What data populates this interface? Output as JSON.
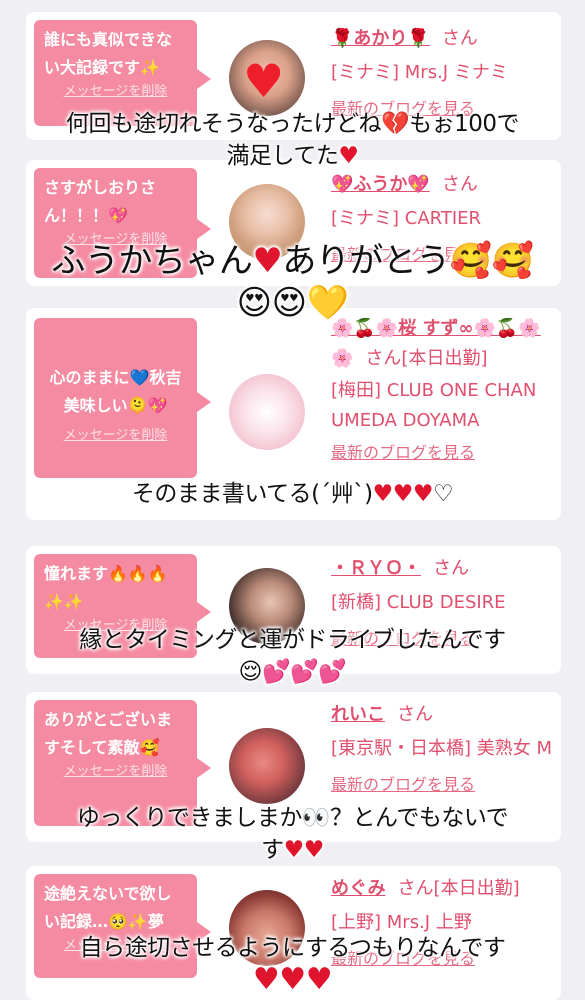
{
  "colors": {
    "accent": "#f58ba2",
    "pink_text": "#e0506e",
    "page_bg": "#f0eff4"
  },
  "delete_label": "メッセージを削除",
  "blog_label": "最新のブログを見る",
  "san": "さん",
  "cards": [
    {
      "message": "誰にも真似できない大記録です✨",
      "name": "🌹あかり🌹",
      "san_suffix": "さん",
      "shop": "[ミナミ] Mrs.J ミナミ"
    },
    {
      "message": "さすがしおりさん！！！💖",
      "name": "💖ふうか💖",
      "san_suffix": "さん",
      "shop": "[ミナミ] CARTIER"
    },
    {
      "message": "心のままに💙秋吉美味しい🫠💖",
      "name": "🌸🍒🌸桜 すず∞🌸🍒🌸",
      "san_suffix": "さん[本日出勤]",
      "shop": "[梅田] CLUB ONE CHAN UMEDA DOYAMA"
    },
    {
      "message": "憧れます🔥🔥🔥✨✨",
      "name": "・ＲＹＯ・",
      "san_suffix": "さん",
      "shop": "[新橋] CLUB DESIRE"
    },
    {
      "message": "ありがとございますそして素敵🥰",
      "name": "れいこ",
      "san_suffix": "さん",
      "shop": "[東京駅・日本橋] 美熟女 M"
    },
    {
      "message": "途絶えないで欲しい記録…🥺✨夢",
      "name": "めぐみ",
      "san_suffix": "さん[本日出勤]",
      "shop": "[上野] Mrs.J 上野"
    }
  ],
  "overlays": [
    {
      "line1": "何回も途切れそうなったけどね💔もぉ100で",
      "line2": "満足してた"
    },
    {
      "line1": "ふうかちゃん",
      "line1b": "ありがとう🥰🥰",
      "line2": "😍😍💛"
    },
    {
      "line1": "そのまま書いてる(´艸`)",
      "line1b": "♡"
    },
    {
      "line1": "縁とタイミングと運がドライブしたんです",
      "line2": "😌💕💕💕"
    },
    {
      "line1": "ゆっくりできましまか👀？とんでもないで",
      "line2": "す"
    },
    {
      "line1": "自ら途切させるようにするつもりなんです"
    }
  ]
}
